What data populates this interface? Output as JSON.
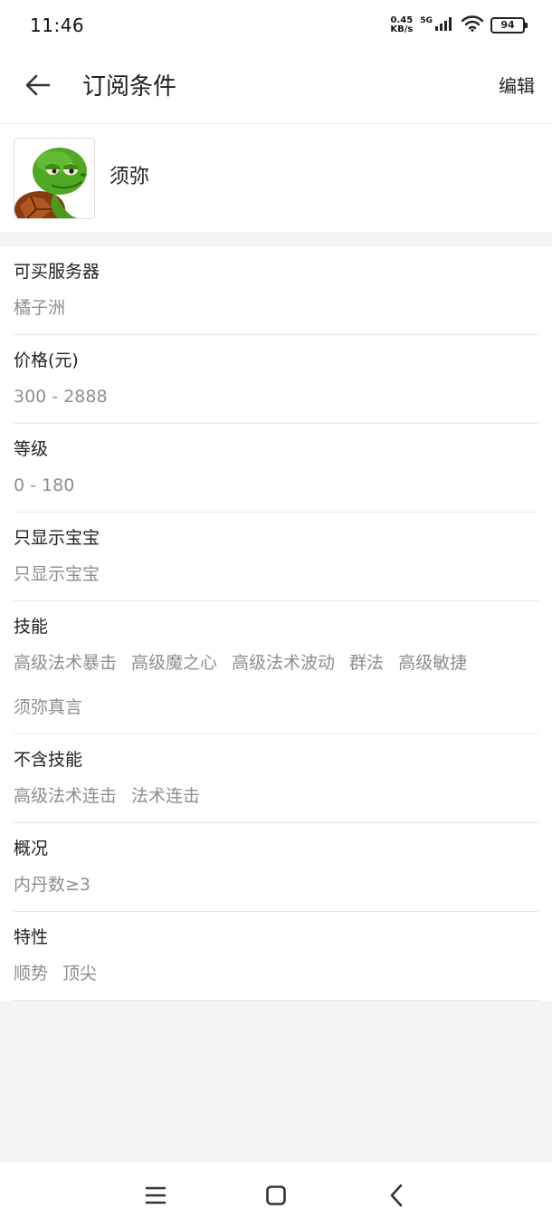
{
  "status_bar": {
    "time": "11:46",
    "net_speed_value": "0.45",
    "net_speed_unit": "KB/s",
    "network_type": "5G",
    "battery": "94",
    "icons": [
      "signal-icon",
      "wifi-icon",
      "battery-icon"
    ]
  },
  "header": {
    "title": "订阅条件",
    "edit_label": "编辑",
    "back_icon": "arrow-left-icon"
  },
  "pet": {
    "name": "须弥",
    "avatar_icon": "turtle-avatar"
  },
  "conditions": [
    {
      "label": "可买服务器",
      "values": [
        "橘子洲"
      ]
    },
    {
      "label": "价格(元)",
      "values": [
        "300 - 2888"
      ]
    },
    {
      "label": "等级",
      "values": [
        "0 - 180"
      ]
    },
    {
      "label": "只显示宝宝",
      "values": [
        "只显示宝宝"
      ]
    },
    {
      "label": "技能",
      "values": [
        "高级法术暴击",
        "高级魔之心",
        "高级法术波动",
        "群法",
        "高级敏捷",
        "须弥真言"
      ]
    },
    {
      "label": "不含技能",
      "values": [
        "高级法术连击",
        "法术连击"
      ]
    },
    {
      "label": "概况",
      "values": [
        "内丹数≥3"
      ]
    },
    {
      "label": "特性",
      "values": [
        "顺势",
        "顶尖"
      ]
    }
  ],
  "nav_bar": {
    "icons": [
      "menu-icon",
      "home-icon",
      "back-icon"
    ]
  },
  "colors": {
    "background": "#f4f4f4",
    "card": "#ffffff",
    "primary_text": "#222222",
    "secondary_text": "#8e8e8e",
    "divider": "#e8e8e8"
  }
}
